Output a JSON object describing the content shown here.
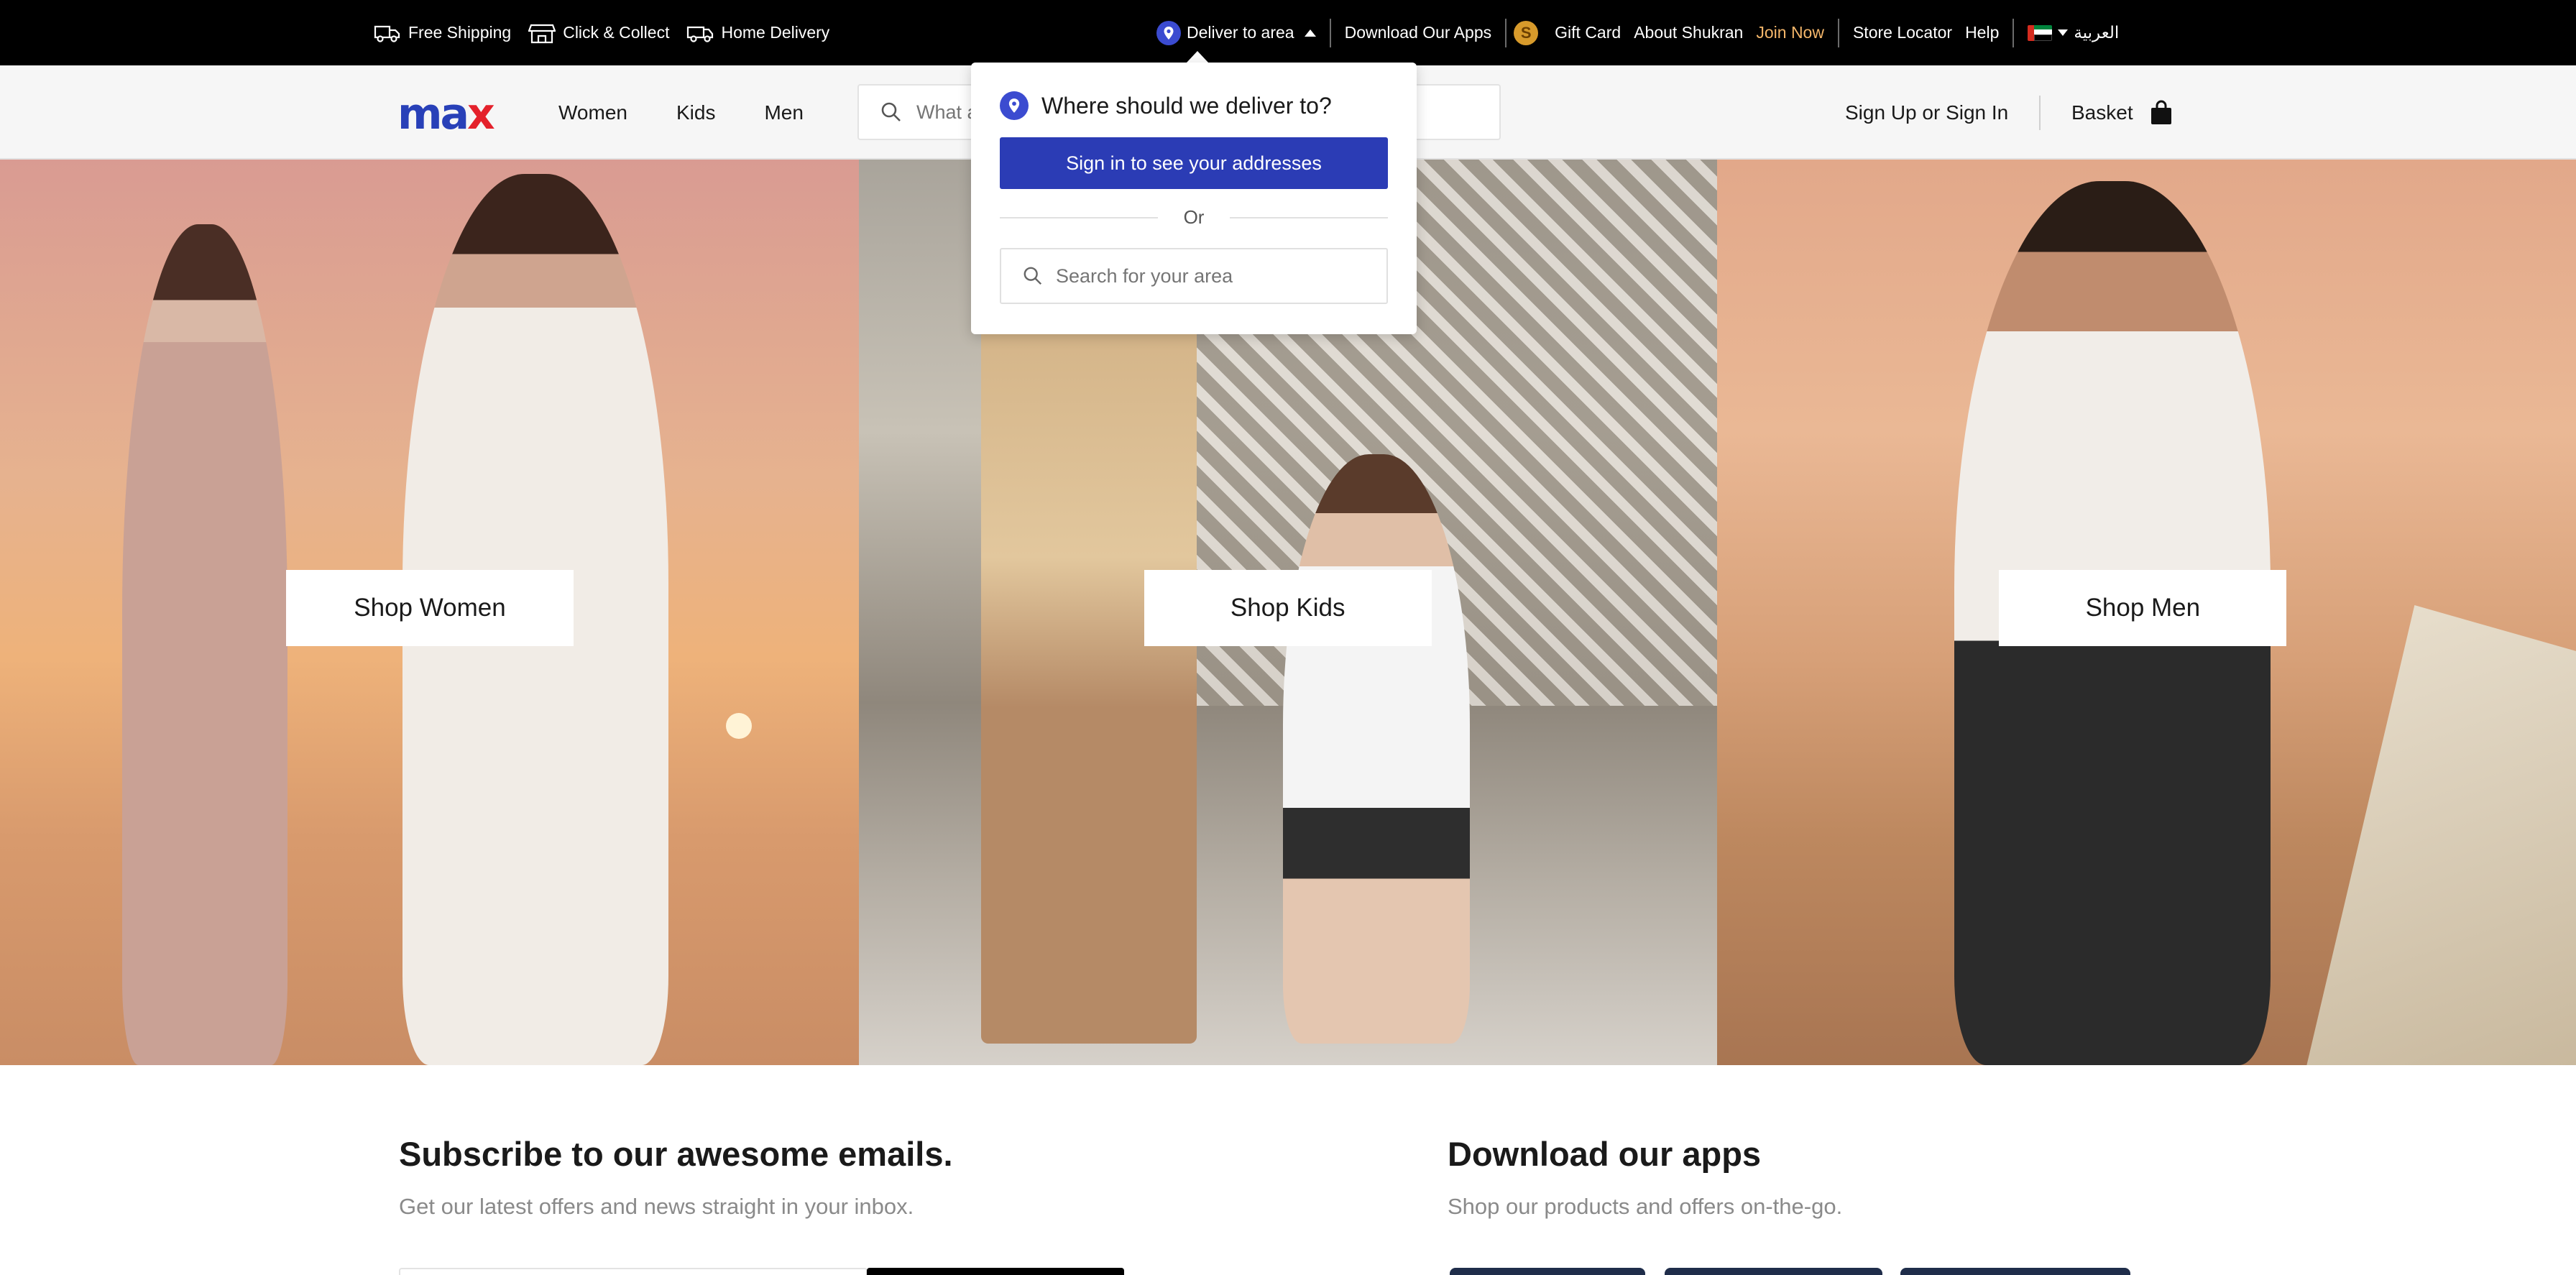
{
  "topbar": {
    "services": [
      {
        "label": "Free Shipping",
        "icon": "truck-icon"
      },
      {
        "label": "Click & Collect",
        "icon": "store-icon"
      },
      {
        "label": "Home Delivery",
        "icon": "delivery-van-icon"
      }
    ],
    "deliver_to": "Deliver to area",
    "download_apps": "Download Our Apps",
    "gift_card": "Gift Card",
    "about_shukran": "About Shukran",
    "join_now": "Join Now",
    "store_locator": "Store Locator",
    "help": "Help",
    "language": "العربية",
    "coin_symbol": "S"
  },
  "header": {
    "logo_main": "ma",
    "logo_accent": "x",
    "nav": [
      "Women",
      "Kids",
      "Men"
    ],
    "search_placeholder": "What a",
    "account": "Sign Up or Sign In",
    "basket": "Basket"
  },
  "hero": {
    "panels": [
      {
        "label": "Shop Women"
      },
      {
        "label": "Shop Kids"
      },
      {
        "label": "Shop Men"
      }
    ]
  },
  "subscribe": {
    "title": "Subscribe to our awesome emails.",
    "subtitle": "Get our latest offers and news straight in your inbox."
  },
  "apps": {
    "title": "Download our apps",
    "subtitle": "Shop our products and offers on-the-go."
  },
  "delivery_popover": {
    "title": "Where should we deliver to?",
    "signin_button": "Sign in to see your addresses",
    "or": "Or",
    "search_placeholder": "Search for your area"
  },
  "colors": {
    "brand_blue": "#2840b8",
    "brand_red": "#e4212b",
    "button_blue": "#2b3cb5",
    "join_now": "#f4b66a"
  }
}
